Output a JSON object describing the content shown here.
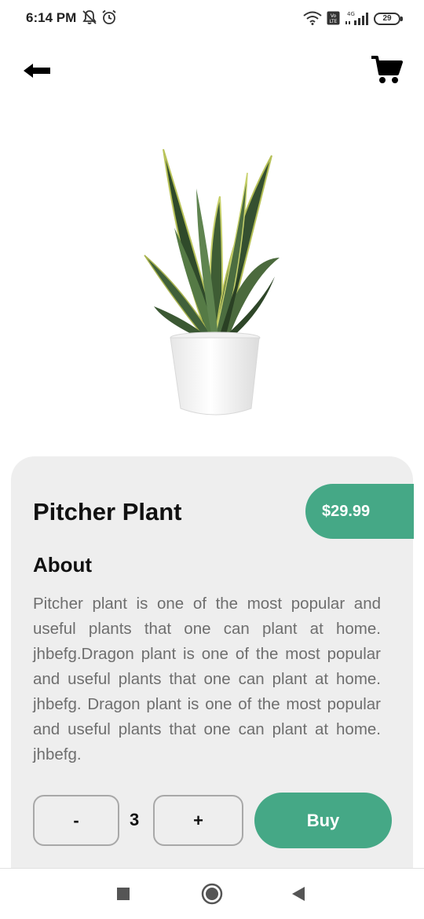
{
  "status_bar": {
    "time": "6:14 PM",
    "battery_level": "29",
    "icons": [
      "mute-icon",
      "alarm-icon",
      "wifi-icon",
      "volte-icon",
      "signal-icon",
      "battery-icon"
    ]
  },
  "header": {
    "back_icon": "arrow-left-icon",
    "cart_icon": "cart-icon"
  },
  "product": {
    "name": "Pitcher Plant",
    "price": "$29.99",
    "about_heading": "About",
    "about_text": "Pitcher plant is one of the most popular and useful plants that one can plant at home. jhbefg.Dragon plant is one of the most popular and useful plants that one can plant at home. jhbefg. Dragon plant is one of the most popular and useful plants that one can plant at home. jhbefg."
  },
  "quantity": {
    "minus_label": "-",
    "value": "3",
    "plus_label": "+"
  },
  "actions": {
    "buy_label": "Buy"
  },
  "colors": {
    "accent": "#45a886",
    "card_background": "#eeeeee",
    "body_text": "#6e6e6e"
  },
  "nav_bar": {
    "icons": [
      "recents-square-icon",
      "home-circle-icon",
      "back-triangle-icon"
    ]
  }
}
